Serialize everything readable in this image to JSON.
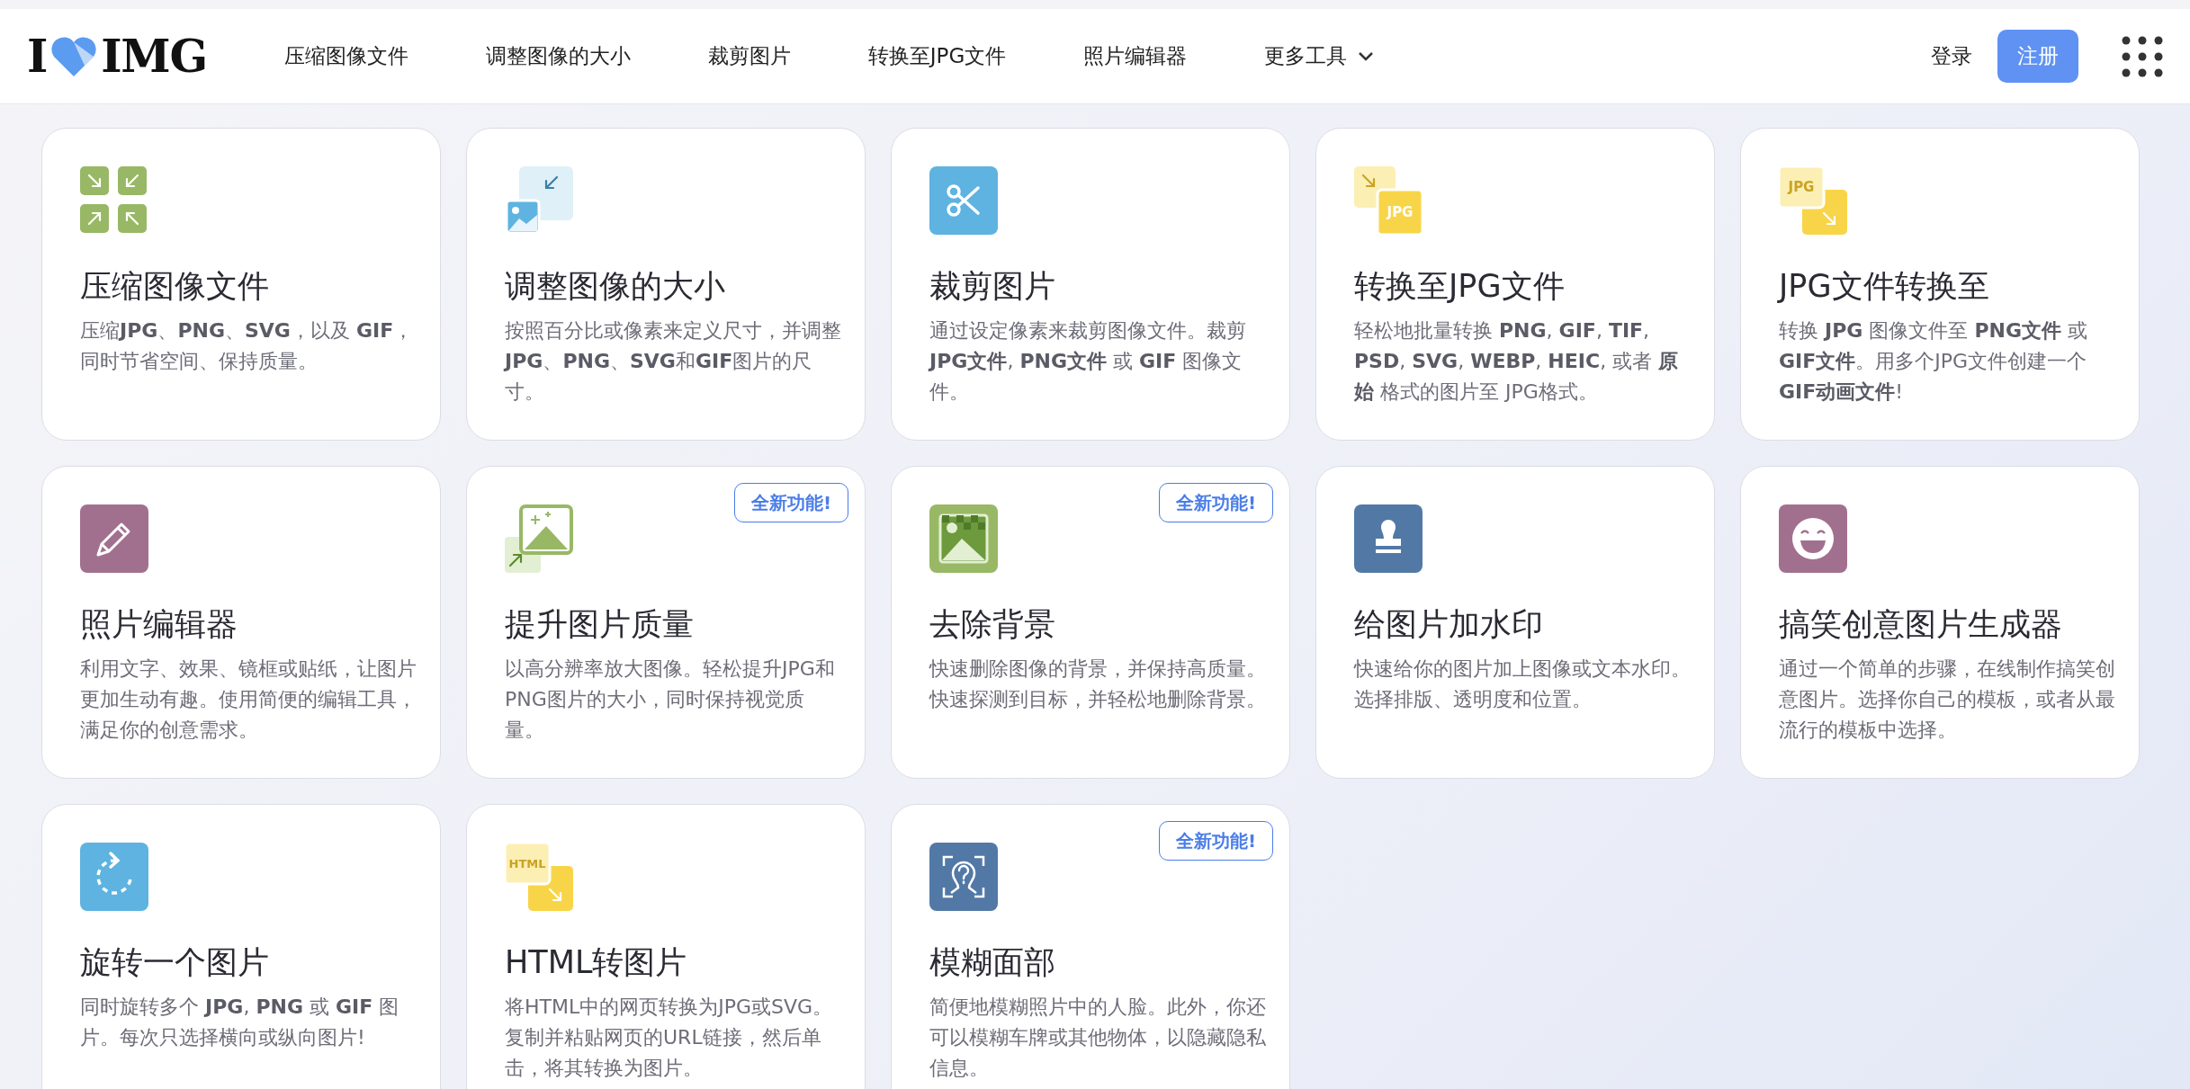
{
  "header": {
    "logo": {
      "left": "I",
      "right": "IMG"
    },
    "nav": [
      {
        "label": "压缩图像文件",
        "kind": "link"
      },
      {
        "label": "调整图像的大小",
        "kind": "link"
      },
      {
        "label": "裁剪图片",
        "kind": "link"
      },
      {
        "label": "转换至JPG文件",
        "kind": "link"
      },
      {
        "label": "照片编辑器",
        "kind": "link"
      },
      {
        "label": "更多工具",
        "kind": "dropdown"
      }
    ],
    "login": "登录",
    "signup": "注册"
  },
  "tools": [
    {
      "kind": "compress",
      "title": "压缩图像文件",
      "description": "压缩**JPG**、**PNG**、**SVG**，以及 **GIF**，同时节省空间、保持质量。"
    },
    {
      "kind": "resize",
      "title": "调整图像的大小",
      "description": "按照百分比或像素来定义尺寸，并调整**JPG**、**PNG**、**SVG**和**GIF**图片的尺寸。"
    },
    {
      "kind": "crop",
      "title": "裁剪图片",
      "description": "通过设定像素来裁剪图像文件。裁剪 **JPG文件**, **PNG文件** 或 **GIF** 图像文件。"
    },
    {
      "kind": "to-jpg",
      "icon_text": "JPG",
      "title": "转换至JPG文件",
      "description": "轻松地批量转换 **PNG**, **GIF**, **TIF**, **PSD**, **SVG**, **WEBP**, **HEIC**, 或者 **原始** 格式的图片至 JPG格式。"
    },
    {
      "kind": "from-jpg",
      "icon_text": "JPG",
      "title": "JPG文件转换至",
      "description": "转换 **JPG** 图像文件至 **PNG文件** 或 **GIF文件**。用多个JPG文件创建一个 **GIF动画文件**!"
    },
    {
      "kind": "edit",
      "title": "照片编辑器",
      "description": "利用文字、效果、镜框或贴纸，让图片更加生动有趣。使用简便的编辑工具，满足你的创意需求。"
    },
    {
      "kind": "upscale",
      "badge": "全新功能!",
      "title": "提升图片质量",
      "description": "以高分辨率放大图像。轻松提升JPG和PNG图片的大小，同时保持视觉质量。"
    },
    {
      "kind": "remove-bg",
      "badge": "全新功能!",
      "title": "去除背景",
      "description": "快速删除图像的背景，并保持高质量。快速探测到目标，并轻松地删除背景。"
    },
    {
      "kind": "watermark",
      "title": "给图片加水印",
      "description": "快速给你的图片加上图像或文本水印。选择排版、透明度和位置。"
    },
    {
      "kind": "meme",
      "title": "搞笑创意图片生成器",
      "description": "通过一个简单的步骤，在线制作搞笑创意图片。选择你自己的模板，或者从最流行的模板中选择。"
    },
    {
      "kind": "rotate",
      "title": "旋转一个图片",
      "description": "同时旋转多个 **JPG**, **PNG** 或 **GIF** 图片。每次只选择横向或纵向图片!"
    },
    {
      "kind": "html",
      "icon_text": "HTML",
      "title": "HTML转图片",
      "description": "将HTML中的网页转换为JPG或SVG。复制并粘贴网页的URL链接，然后单击，将其转换为图片。"
    },
    {
      "kind": "blur-face",
      "badge": "全新功能!",
      "title": "模糊面部",
      "description": "简便地模糊照片中的人脸。此外，你还可以模糊车牌或其他物体，以隐藏隐私信息。"
    }
  ]
}
